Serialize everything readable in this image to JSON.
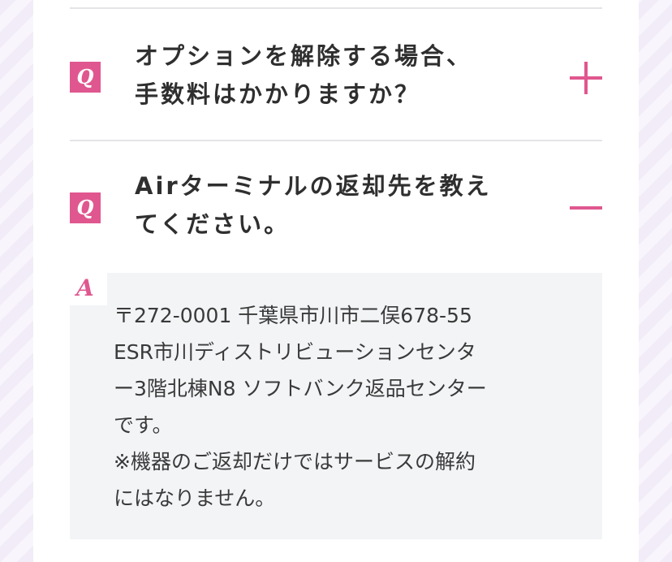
{
  "faq": {
    "items": [
      {
        "q_mark": "Q",
        "question_line1": "オプションを解除する場合、",
        "question_line2": "手数料はかかりますか？",
        "expanded": false
      },
      {
        "q_mark": "Q",
        "question_line1": "Airターミナルの返却先を教え",
        "question_line2": "てください。",
        "expanded": true
      }
    ],
    "answer": {
      "a_mark": "A",
      "line1": "〒272-0001 千葉県市川市二俣678-55",
      "line2": "ESR市川ディストリビューションセンタ",
      "line3": "ー3階北棟N8 ソフトバンク返品センター",
      "line4": "です。",
      "line5": "※機器のご返却だけではサービスの解約",
      "line6": "にはなりません。"
    }
  },
  "colors": {
    "accent": "#e0578f",
    "answer_bg": "#f3f4f6",
    "text": "#2f2f2f"
  },
  "icons": {
    "expand": "plus-icon",
    "collapse": "minus-icon"
  }
}
